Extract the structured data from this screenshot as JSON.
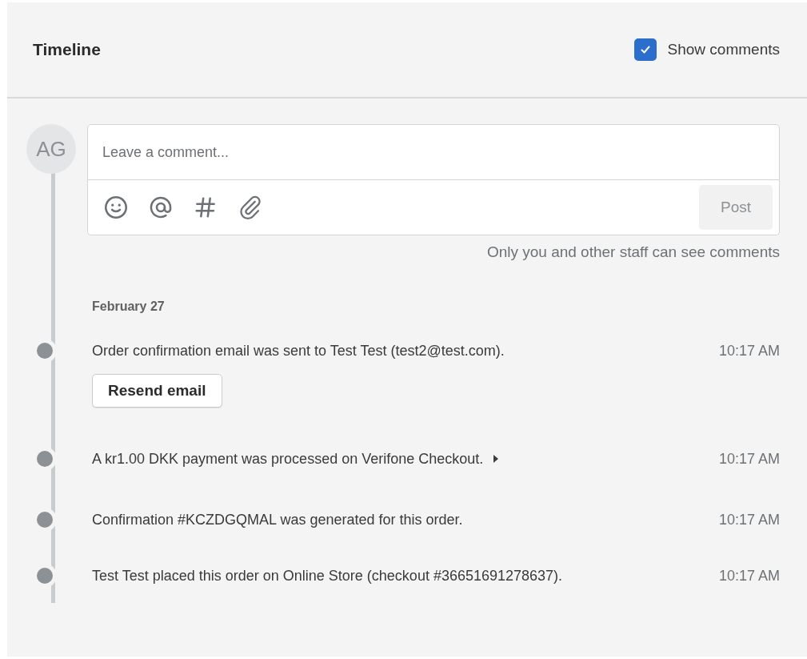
{
  "header": {
    "title": "Timeline",
    "show_comments": {
      "label": "Show comments",
      "checked": true
    }
  },
  "composer": {
    "avatar": "AG",
    "placeholder": "Leave a comment...",
    "post_button": {
      "label": "Post",
      "disabled": true
    },
    "note": "Only you and other staff can see comments"
  },
  "date": "February 27",
  "events": [
    {
      "text": "Order confirmation email was sent to Test Test (test2@test.com).",
      "time": "10:17 AM",
      "action": "Resend email",
      "expandable": false
    },
    {
      "text": "A kr1.00 DKK payment was processed on Verifone Checkout.",
      "time": "10:17 AM",
      "expandable": true
    },
    {
      "text": "Confirmation #KCZDGQMAL was generated for this order.",
      "time": "10:17 AM",
      "expandable": false
    },
    {
      "text": "Test Test placed this order on Online Store (checkout #36651691278637).",
      "time": "10:17 AM",
      "expandable": false
    }
  ]
}
